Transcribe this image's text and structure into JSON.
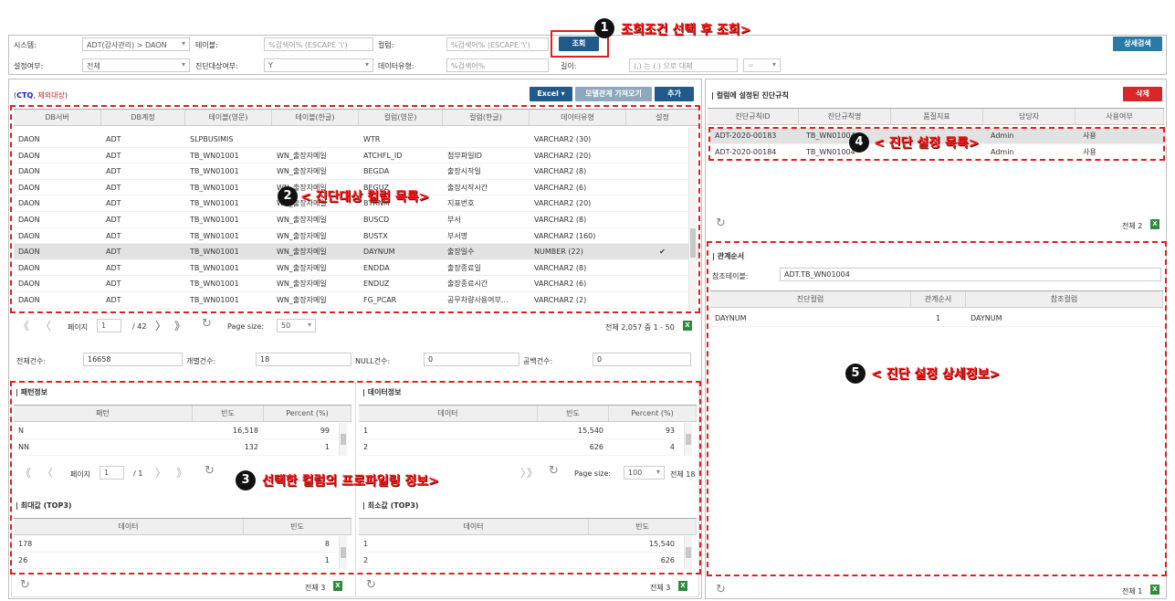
{
  "search": {
    "system_label": "시스템:",
    "system_value": "ADT(감사관리) > DAON",
    "table_label": "테이블:",
    "table_ph": "%검색어% (ESCAPE '\\')",
    "column_label": "컬럼:",
    "column_ph": "%검색어% (ESCAPE '\\')",
    "query_button": "조회",
    "detail_button": "상세검색",
    "setting_label": "설정여부:",
    "setting_value": "전체",
    "target_label": "진단대상여부:",
    "target_value": "Y",
    "datatype_label": "데이터유형:",
    "datatype_ph": "%검색어%",
    "length_label": "길이:",
    "length_ph": "(,) 는 (.) 으로 대체",
    "length_op": "="
  },
  "left": {
    "legend_ctq": "CTQ",
    "legend_sep": ",",
    "legend_excl": "제외대상",
    "excel_button": "Excel",
    "model_button": "모델관계 가져오기",
    "add_button": "추가",
    "columns": [
      "DB서버",
      "DB계정",
      "테이블(영문)",
      "테이블(한글)",
      "컬럼(영문)",
      "컬럼(한글)",
      "데이터유형",
      "설정"
    ],
    "rows": [
      [
        "DAON",
        "ADT",
        "SLPBUSIMIS",
        "",
        "WTR",
        "",
        "VARCHAR2 (30)",
        ""
      ],
      [
        "DAON",
        "ADT",
        "TB_WN01001",
        "WN_출장자메일",
        "ATCHFL_ID",
        "첨부파일ID",
        "VARCHAR2 (20)",
        ""
      ],
      [
        "DAON",
        "ADT",
        "TB_WN01001",
        "WN_출장자메일",
        "BEGDA",
        "출장시작일",
        "VARCHAR2 (8)",
        ""
      ],
      [
        "DAON",
        "ADT",
        "TB_WN01001",
        "WN_출장자메일",
        "BEGUZ",
        "출장시작시간",
        "VARCHAR2 (6)",
        ""
      ],
      [
        "DAON",
        "ADT",
        "TB_WN01001",
        "WN_출장자메일",
        "BTRNM",
        "지표번호",
        "VARCHAR2 (20)",
        ""
      ],
      [
        "DAON",
        "ADT",
        "TB_WN01001",
        "WN_출장자메일",
        "BUSCD",
        "부서",
        "VARCHAR2 (8)",
        ""
      ],
      [
        "DAON",
        "ADT",
        "TB_WN01001",
        "WN_출장자메일",
        "BUSTX",
        "부서명",
        "VARCHAR2 (160)",
        ""
      ],
      [
        "DAON",
        "ADT",
        "TB_WN01001",
        "WN_출장자메일",
        "DAYNUM",
        "출장일수",
        "NUMBER (22)",
        "✔"
      ],
      [
        "DAON",
        "ADT",
        "TB_WN01001",
        "WN_출장자메일",
        "ENDDA",
        "출장종료일",
        "VARCHAR2 (8)",
        ""
      ],
      [
        "DAON",
        "ADT",
        "TB_WN01001",
        "WN_출장자메일",
        "ENDUZ",
        "출장종료시간",
        "VARCHAR2 (6)",
        ""
      ],
      [
        "DAON",
        "ADT",
        "TB_WN01001",
        "WN_출장자메일",
        "FG_PCAR",
        "공무차량사용여부...",
        "VARCHAR2 (2)",
        ""
      ]
    ],
    "pager": {
      "page_label": "페이지",
      "page": "1",
      "total_pages": "/ 42",
      "size_label": "Page size:",
      "size": "50",
      "summary": "전체 2,057 중 1 - 50"
    },
    "stats": {
      "total_label": "전체건수:",
      "total": "16658",
      "distinct_label": "개별건수:",
      "distinct": "18",
      "null_label": "NULL건수:",
      "null": "0",
      "blank_label": "공백건수:",
      "blank": "0"
    },
    "pattern": {
      "title": "| 패턴정보",
      "cols": [
        "패턴",
        "빈도",
        "Percent (%)"
      ],
      "rows": [
        [
          "N",
          "16,518",
          "99"
        ],
        [
          "NN",
          "132",
          "1"
        ]
      ]
    },
    "datainfo": {
      "title": "| 데이터정보",
      "cols": [
        "데이터",
        "빈도",
        "Percent (%)"
      ],
      "rows": [
        [
          "1",
          "15,540",
          "93"
        ],
        [
          "2",
          "626",
          "4"
        ]
      ]
    },
    "pager2": {
      "page_label": "페이지",
      "page": "1",
      "total_pages": "/ 1",
      "size_label": "Page size:",
      "size": "100",
      "summary": "전체 18"
    },
    "max": {
      "title": "| 최대값 (TOP3)",
      "cols": [
        "데이터",
        "빈도"
      ],
      "rows": [
        [
          "178",
          "8"
        ],
        [
          "26",
          "1"
        ]
      ],
      "total": "전체 3"
    },
    "min": {
      "title": "| 최소값 (TOP3)",
      "cols": [
        "데이터",
        "빈도"
      ],
      "rows": [
        [
          "1",
          "15,540"
        ],
        [
          "2",
          "626"
        ]
      ],
      "total": "전체 3"
    }
  },
  "right": {
    "rules_title": "| 컬럼에 설정된 진단규칙",
    "delete_button": "삭제",
    "rule_cols": [
      "진단규칙ID",
      "진단규칙명",
      "품질지표",
      "담당자",
      "사용여부"
    ],
    "rules": [
      [
        "ADT-2020-00183",
        "TB_WN01004",
        "",
        "Admin",
        "사용"
      ],
      [
        "ADT-2020-00184",
        "TB_WN01004",
        "",
        "Admin",
        "사용"
      ]
    ],
    "rules_total": "전체 2",
    "rel_title": "| 관계순서",
    "ref_table_label": "참조테이블:",
    "ref_table": "ADT.TB_WN01004",
    "rel_cols": [
      "진단컬럼",
      "관계순서",
      "참조컬럼"
    ],
    "rel_rows": [
      [
        "DAYNUM",
        "1",
        "DAYNUM"
      ]
    ],
    "rel_total": "전체 1"
  },
  "annotations": {
    "a1": "조회조건 선택 후 조회>",
    "a2": "< 진단대상 컬럼 목록>",
    "a3": "선택한 컬럼의 프로파일링 정보>",
    "a4": "< 진단 설정 목록>",
    "a5": "< 진단 설정 상세정보>",
    "n1": "1",
    "n2": "2",
    "n3": "3",
    "n4": "4",
    "n5": "5"
  },
  "colors": {
    "navy": "#1f5a8a",
    "red": "#d9262b",
    "annotation": "#ff1a1a"
  }
}
